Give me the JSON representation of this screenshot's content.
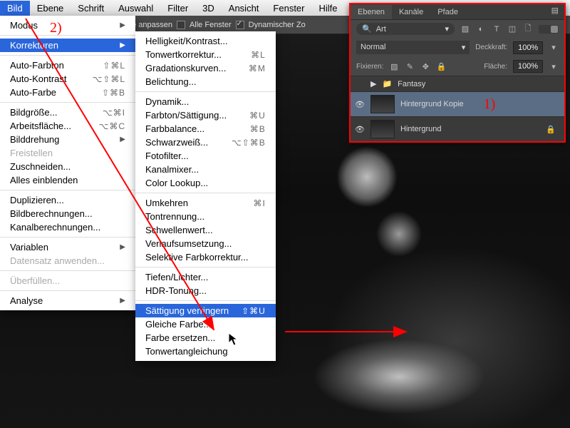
{
  "menubar": {
    "items": [
      "Bild",
      "Ebene",
      "Schrift",
      "Auswahl",
      "Filter",
      "3D",
      "Ansicht",
      "Fenster",
      "Hilfe"
    ],
    "active_index": 0
  },
  "optbar": {
    "fit": "nstergröße anpassen",
    "allwin": "Alle Fenster",
    "dynzoom": "Dynamischer Zo"
  },
  "doctab": ")  *",
  "menu_bild": [
    {
      "t": "Modus",
      "arrow": true
    },
    {
      "sep": true
    },
    {
      "t": "Korrekturen",
      "arrow": true,
      "hi": true
    },
    {
      "sep": true
    },
    {
      "t": "Auto-Farbton",
      "sc": "⇧⌘L"
    },
    {
      "t": "Auto-Kontrast",
      "sc": "⌥⇧⌘L"
    },
    {
      "t": "Auto-Farbe",
      "sc": "⇧⌘B"
    },
    {
      "sep": true
    },
    {
      "t": "Bildgröße...",
      "sc": "⌥⌘I"
    },
    {
      "t": "Arbeitsfläche...",
      "sc": "⌥⌘C"
    },
    {
      "t": "Bilddrehung",
      "arrow": true
    },
    {
      "t": "Freistellen",
      "dis": true
    },
    {
      "t": "Zuschneiden..."
    },
    {
      "t": "Alles einblenden"
    },
    {
      "sep": true
    },
    {
      "t": "Duplizieren..."
    },
    {
      "t": "Bildberechnungen..."
    },
    {
      "t": "Kanalberechnungen..."
    },
    {
      "sep": true
    },
    {
      "t": "Variablen",
      "arrow": true
    },
    {
      "t": "Datensatz anwenden...",
      "dis": true
    },
    {
      "sep": true
    },
    {
      "t": "Überfüllen...",
      "dis": true
    },
    {
      "sep": true
    },
    {
      "t": "Analyse",
      "arrow": true
    }
  ],
  "menu_korr": [
    {
      "t": "Helligkeit/Kontrast..."
    },
    {
      "t": "Tonwertkorrektur...",
      "sc": "⌘L"
    },
    {
      "t": "Gradationskurven...",
      "sc": "⌘M"
    },
    {
      "t": "Belichtung..."
    },
    {
      "sep": true
    },
    {
      "t": "Dynamik..."
    },
    {
      "t": "Farbton/Sättigung...",
      "sc": "⌘U"
    },
    {
      "t": "Farbbalance...",
      "sc": "⌘B"
    },
    {
      "t": "Schwarzweiß...",
      "sc": "⌥⇧⌘B"
    },
    {
      "t": "Fotofilter..."
    },
    {
      "t": "Kanalmixer..."
    },
    {
      "t": "Color Lookup..."
    },
    {
      "sep": true
    },
    {
      "t": "Umkehren",
      "sc": "⌘I"
    },
    {
      "t": "Tontrennung..."
    },
    {
      "t": "Schwellenwert..."
    },
    {
      "t": "Verlaufsumsetzung..."
    },
    {
      "t": "Selektive Farbkorrektur..."
    },
    {
      "sep": true
    },
    {
      "t": "Tiefen/Lichter..."
    },
    {
      "t": "HDR-Tonung..."
    },
    {
      "sep": true
    },
    {
      "t": "Sättigung verringern",
      "sc": "⇧⌘U",
      "hi": true
    },
    {
      "t": "Gleiche Farbe..."
    },
    {
      "t": "Farbe ersetzen..."
    },
    {
      "t": "Tonwertangleichung"
    }
  ],
  "layers_panel": {
    "tabs": [
      "Ebenen",
      "Kanäle",
      "Pfade"
    ],
    "active_tab": 0,
    "search_mode": "Art",
    "blend": "Normal",
    "opacity_label": "Deckkraft:",
    "opacity": "100%",
    "lock_label": "Fixieren:",
    "fill_label": "Fläche:",
    "fill": "100%",
    "group": "Fantasy",
    "layer_selected": "Hintergrund Kopie",
    "layer_bg": "Hintergrund"
  },
  "annotations": {
    "step1": "1)",
    "step2": "2)"
  }
}
